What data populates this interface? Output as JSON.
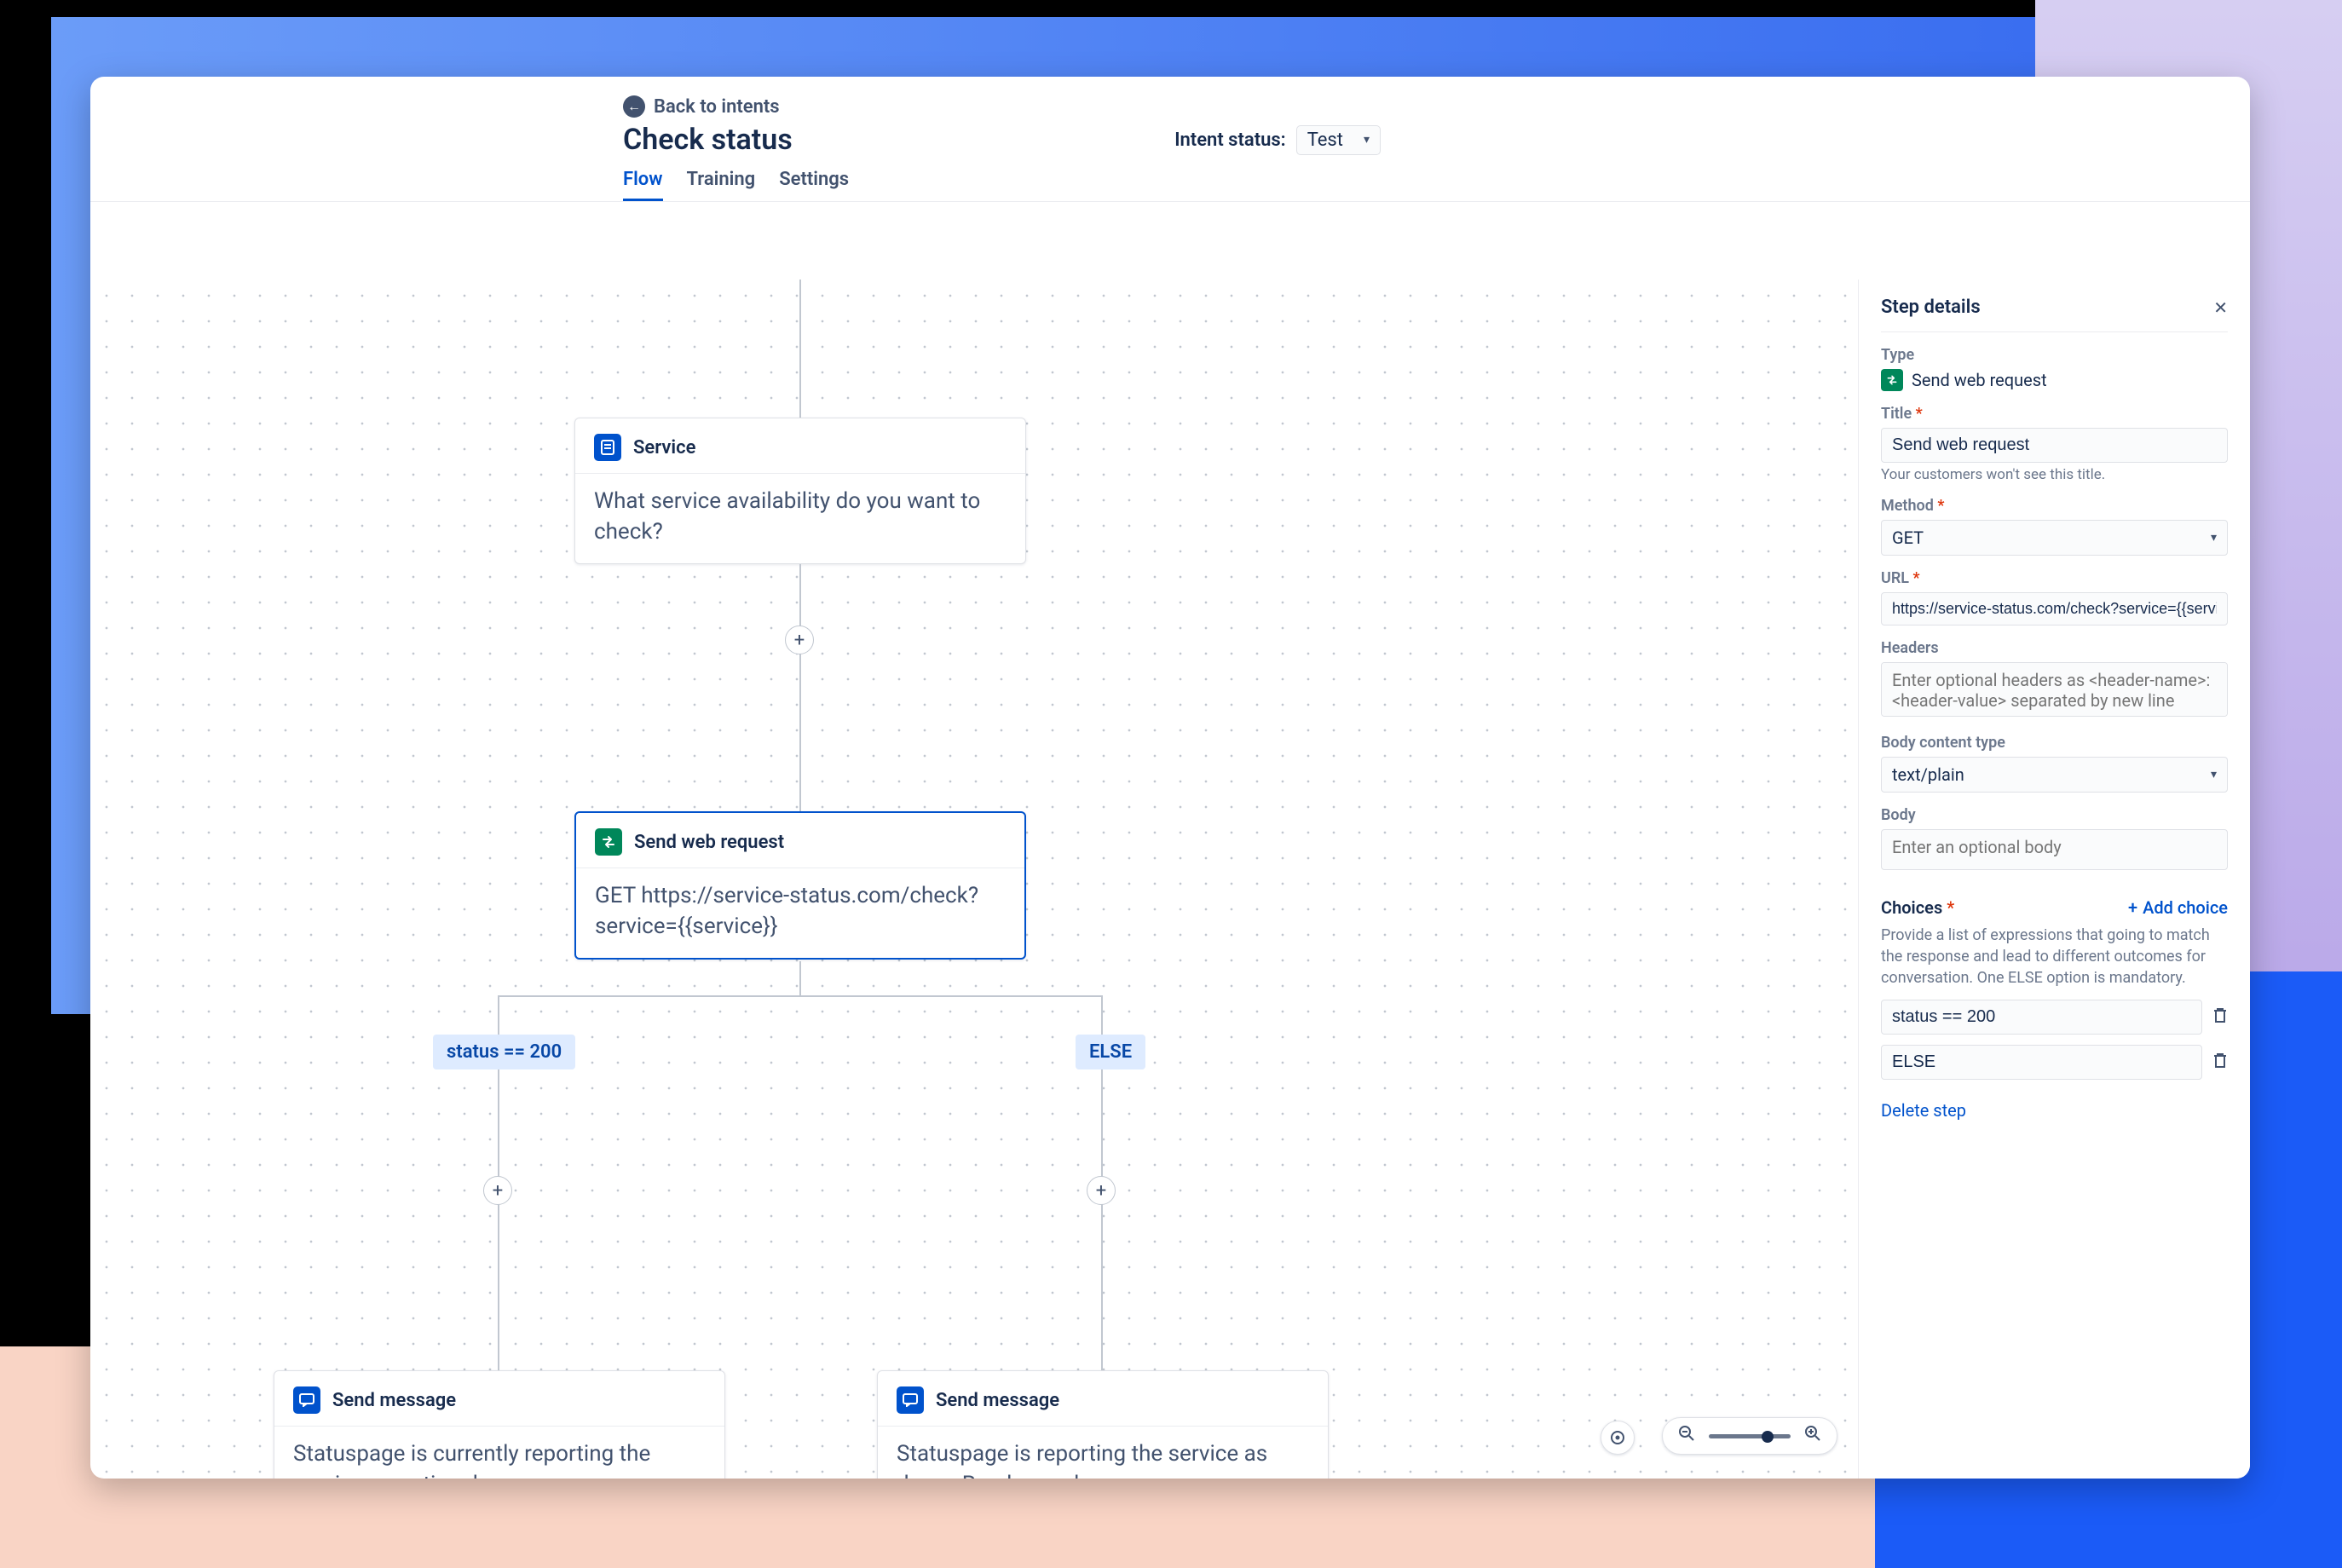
{
  "header": {
    "back_label": "Back to intents",
    "title": "Check status",
    "status_label": "Intent status:",
    "status_value": "Test",
    "tabs": {
      "flow": "Flow",
      "training": "Training",
      "settings": "Settings"
    }
  },
  "nodes": {
    "service": {
      "title": "Service",
      "body": "What service availability do you want to check?"
    },
    "webreq": {
      "title": "Send web request",
      "body": "GET https://service-status.com/check?service={{service}}"
    },
    "branches": {
      "left": "status == 200",
      "right": "ELSE"
    },
    "msg_left": {
      "title": "Send message",
      "body": "Statuspage is currently reporting the service as optional."
    },
    "msg_right": {
      "title": "Send message",
      "body": "Statuspage is reporting the service as down. Read more here."
    }
  },
  "panel": {
    "heading": "Step details",
    "type_label": "Type",
    "type_value": "Send web request",
    "title_label": "Title",
    "title_value": "Send web request",
    "title_hint": "Your customers won't see this title.",
    "method_label": "Method",
    "method_value": "GET",
    "url_label": "URL",
    "url_value": "https://service-status.com/check?service={{service}}",
    "headers_label": "Headers",
    "headers_placeholder": "Enter optional headers as <header-name>:<header-value> separated by new line",
    "body_type_label": "Body content type",
    "body_type_value": "text/plain",
    "body_label": "Body",
    "body_placeholder": "Enter an optional body",
    "choices_label": "Choices",
    "add_choice": "Add choice",
    "choices_desc": "Provide a list of expressions that going to match the response and lead to different outcomes for conversation. One ELSE option is mandatory.",
    "choices": [
      "status == 200",
      "ELSE"
    ],
    "delete_step": "Delete step"
  }
}
